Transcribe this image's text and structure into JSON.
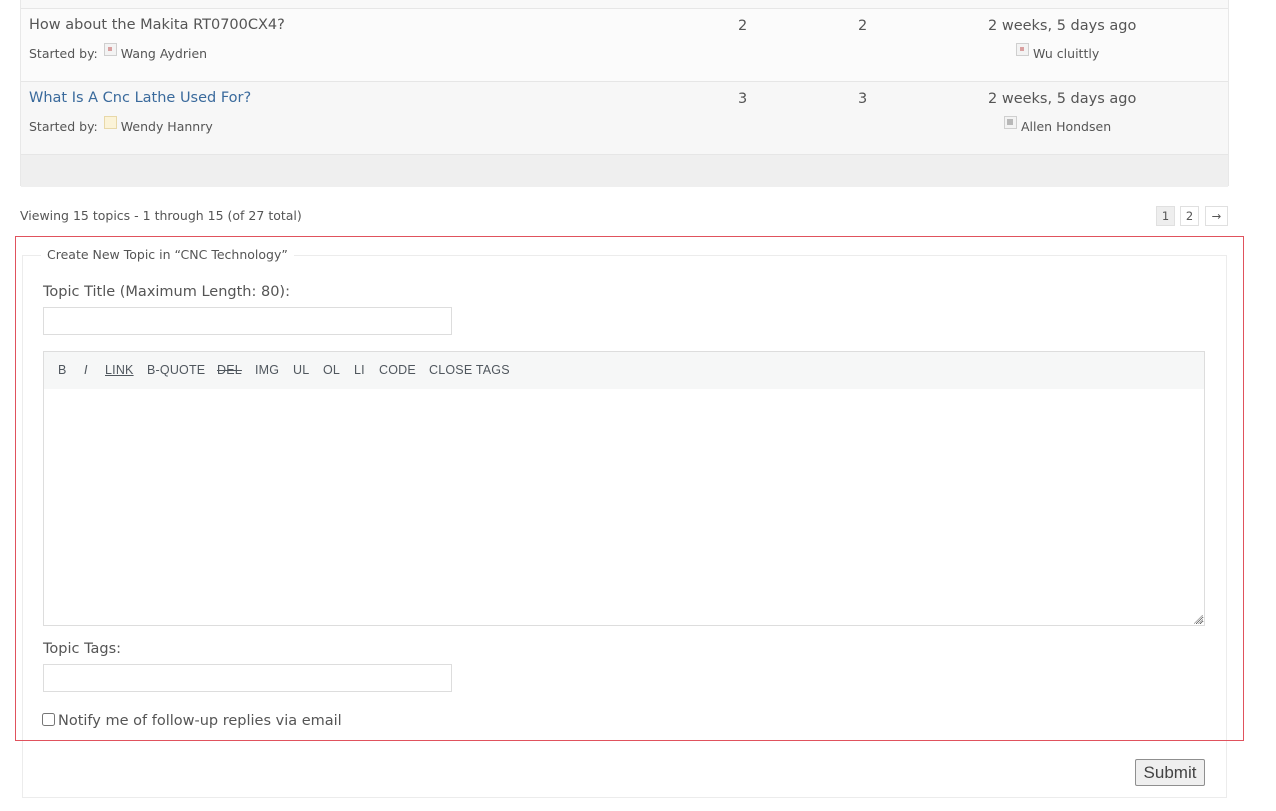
{
  "topics": [
    {
      "title": "How about the Makita RT0700CX4?",
      "started_by_label": "Started by:",
      "author": "Wang Aydrien",
      "voices": "2",
      "posts": "2",
      "freshness": "2 weeks, 5 days ago",
      "last_author": "Wu cluittly"
    },
    {
      "title": "What Is A Cnc Lathe Used For?",
      "started_by_label": "Started by:",
      "author": "Wendy Hannry",
      "voices": "3",
      "posts": "3",
      "freshness": "2 weeks, 5 days ago",
      "last_author": "Allen Hondsen"
    }
  ],
  "pagination": {
    "summary": "Viewing 15 topics - 1 through 15 (of 27 total)",
    "current": "1",
    "page2": "2",
    "next": "→"
  },
  "form": {
    "legend": "Create New Topic in “CNC Technology”",
    "title_label": "Topic Title (Maximum Length: 80):",
    "title_value": "",
    "quicktags": [
      "B",
      "I",
      "LINK",
      "B-QUOTE",
      "DEL",
      "IMG",
      "UL",
      "OL",
      "LI",
      "CODE",
      "CLOSE TAGS"
    ],
    "content_value": "",
    "tags_label": "Topic Tags:",
    "tags_value": "",
    "notify_label": "Notify me of follow-up replies via email",
    "notify_checked": false,
    "submit_label": "Submit"
  },
  "colors": {
    "link": "#3a6a9c",
    "highlight_border": "#e0525d"
  }
}
